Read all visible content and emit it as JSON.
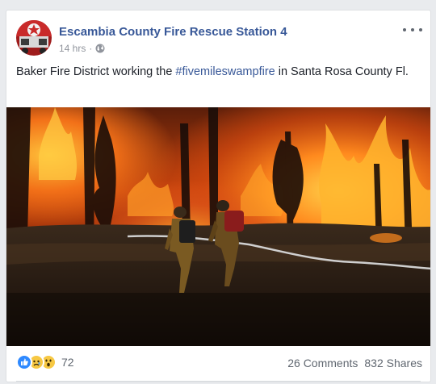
{
  "post": {
    "page_name": "Escambia County Fire Rescue Station 4",
    "timestamp": "14 hrs",
    "separator": "·",
    "privacy_icon": "globe-icon",
    "text_before": "Baker Fire District working the ",
    "hashtag": "#fivemileswampfire",
    "text_after": " in Santa Rosa County Fl.",
    "photo_icon": "wildfire-firefighters-photo",
    "reactions": {
      "icons": [
        "like-reaction-icon",
        "sad-reaction-icon",
        "wow-reaction-icon"
      ],
      "count": "72"
    },
    "comments": "26 Comments",
    "shares": "832 Shares"
  },
  "colors": {
    "link": "#385898",
    "meta": "#90949c",
    "like_blue": "#2e89ff",
    "emoji_yellow": "#f7c843"
  }
}
